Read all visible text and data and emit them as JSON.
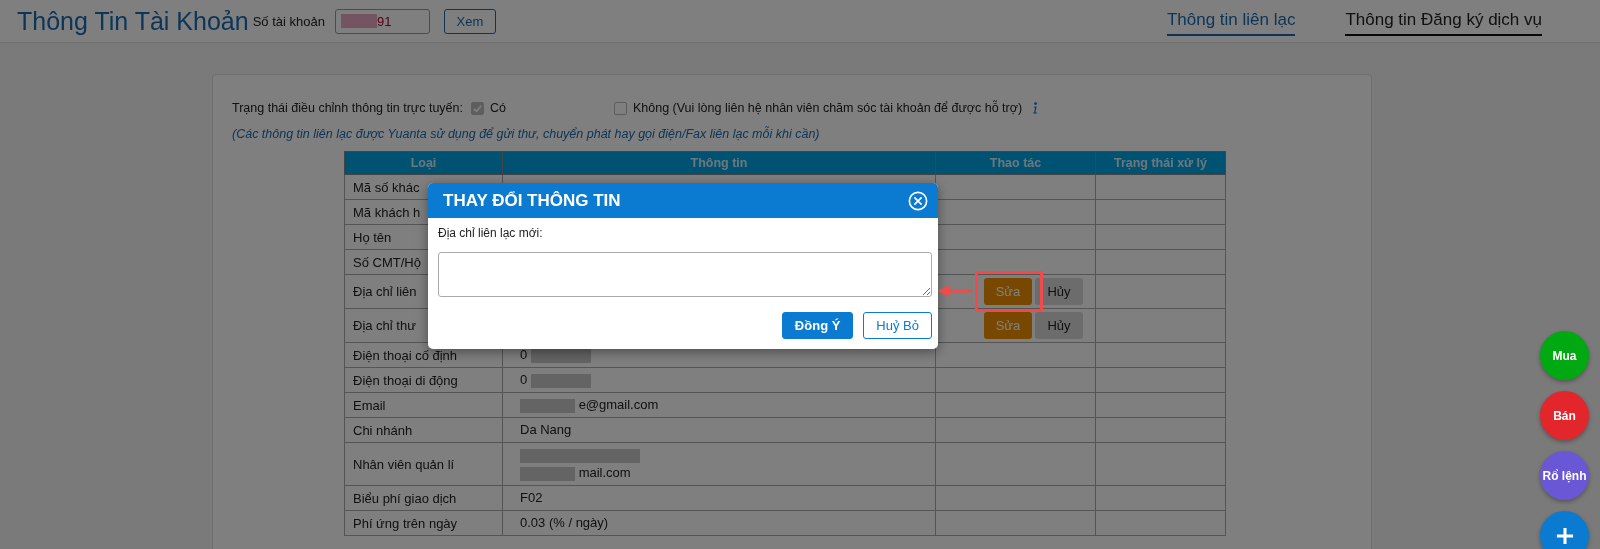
{
  "header": {
    "title": "Thông Tin Tài Khoản",
    "account_label": "Số tài khoản",
    "account_value": "91",
    "view_button": "Xem"
  },
  "tabs": [
    {
      "label": "Thông tin liên lạc",
      "selected": true
    },
    {
      "label": "Thông tin Đăng ký dịch vụ",
      "selected": false
    }
  ],
  "status": {
    "label": "Trạng thái điều chỉnh thông tin trực tuyến:",
    "options": [
      {
        "label": "Có",
        "checked": true,
        "disabled": true
      },
      {
        "label": "Không (Vui lòng liên hệ nhân viên chăm sóc tài khoản để được hỗ trợ)",
        "checked": false,
        "disabled": false
      }
    ]
  },
  "note": "(Các thông tin liên lạc được Yuanta sử dụng để gửi thư, chuyển phát hay gọi điện/Fax liên lạc mỗi khi cần)",
  "table": {
    "columns": [
      "Loại",
      "Thông tin",
      "Thao tác",
      "Trạng thái xử lý"
    ],
    "rows": [
      {
        "type": "Mã số khác"
      },
      {
        "type": "Mã khách h"
      },
      {
        "type": "Họ tên"
      },
      {
        "type": "Số CMT/Hộ"
      },
      {
        "type": "Địa chỉ liên",
        "actions": [
          "Sửa",
          "Hủy"
        ],
        "highlighted": true
      },
      {
        "type": "Địa chỉ thư",
        "actions": [
          "Sửa",
          "Hủy"
        ],
        "highlighted": false
      },
      {
        "type": "Điện thoại cố định",
        "info": [
          {
            "text": "0",
            "redacted_before": false,
            "redacted_after": true
          }
        ]
      },
      {
        "type": "Điện thoại di động",
        "info": [
          {
            "text": "0",
            "redacted_before": false,
            "redacted_after": true
          }
        ]
      },
      {
        "type": "Email",
        "info": [
          {
            "text": "e@gmail.com",
            "redacted_before": true,
            "redacted_after": false
          }
        ]
      },
      {
        "type": "Chi nhánh",
        "info": [
          {
            "text": "Da Nang",
            "redacted_before": false,
            "redacted_after": false
          }
        ]
      },
      {
        "type": "Nhân viên quản lí",
        "info": [
          {
            "redacted_before": true,
            "redacted_after": false
          },
          {
            "text": "mail.com",
            "redacted_before": true,
            "redacted_after": false
          }
        ]
      },
      {
        "type": "Biểu phí giao dịch",
        "info": [
          {
            "text": "F02",
            "redacted_before": false,
            "redacted_after": false
          }
        ]
      },
      {
        "type": "Phí ứng trên ngày",
        "info": [
          {
            "text": "0.03 (% / ngày)",
            "redacted_before": false,
            "redacted_after": false
          }
        ]
      }
    ]
  },
  "modal": {
    "title": "THAY ĐỔI THÔNG TIN",
    "field_label": "Địa chỉ liên lạc mới:",
    "buttons": [
      {
        "label": "Đồng Ý",
        "kind": "primary"
      },
      {
        "label": "Huỷ Bỏ",
        "kind": "secondary"
      }
    ]
  },
  "floating": [
    {
      "kind": "text",
      "label": "Mua",
      "color": "#00a812"
    },
    {
      "kind": "text",
      "label": "Bán",
      "color": "#e3262b"
    },
    {
      "kind": "text",
      "label": "Rổ lệnh",
      "color": "#6a57d6"
    },
    {
      "kind": "add",
      "color": "#0a7bd1"
    }
  ]
}
